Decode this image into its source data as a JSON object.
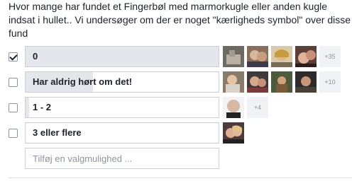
{
  "question": "Hvor mange har fundet et Fingerbøl med marmorkugle eller anden kugle indsat i hullet.. Vi undersøger om der er noget \"kærligheds symbol\" over disse fund",
  "options": [
    {
      "label": "0",
      "checked": true,
      "fill_fraction": 1.0,
      "more": "+35"
    },
    {
      "label": "Har aldrig hørt om det!",
      "checked": false,
      "fill_fraction": 0.35,
      "more": "+10"
    },
    {
      "label": "1 - 2",
      "checked": false,
      "fill_fraction": 0.02,
      "more": "+4"
    },
    {
      "label": "3 eller flere",
      "checked": false,
      "fill_fraction": 0.0,
      "more": ""
    }
  ],
  "add_option_placeholder": "Tilføj en valgmulighed ...",
  "icons": {
    "checkbox": "checkbox-icon",
    "avatar": "profile-avatar-icon"
  },
  "colors": {
    "fill": "#e4e6eb",
    "border": "#ccd0d5",
    "text": "#1d2129",
    "muted": "#8d949e"
  }
}
